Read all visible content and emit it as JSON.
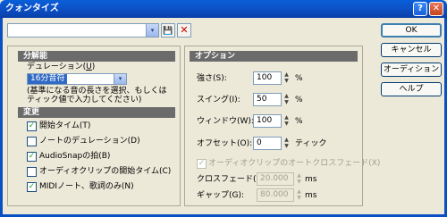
{
  "window": {
    "title": "クォンタイズ",
    "help": "?",
    "close": "✕"
  },
  "toolbar": {
    "preset_value": "",
    "dropdown_glyph": "▾",
    "save_glyph": "💾",
    "delete_glyph": "✕"
  },
  "resolution": {
    "header": "分解能",
    "duration_label": "デュレーション(",
    "duration_accel": "U",
    "duration_value": "16分音符",
    "help_text_1": "(基準になる音の長さを選択、もしくは",
    "help_text_2": "ティック値で入力してください)"
  },
  "changes": {
    "header": "変更",
    "items": [
      {
        "label": "開始タイム(T)",
        "checked": true
      },
      {
        "label": "ノートのデュレーション(D)",
        "checked": false
      },
      {
        "label": "AudioSnapの拍(B)",
        "checked": true
      },
      {
        "label": "オーディオクリップの開始タイム(C)",
        "checked": false
      },
      {
        "label": "MIDIノート、歌詞のみ(N)",
        "checked": true
      }
    ]
  },
  "options": {
    "header": "オプション",
    "strength": {
      "label": "強さ(S):",
      "value": "100",
      "unit": "%"
    },
    "swing": {
      "label": "スイング(I):",
      "value": "50",
      "unit": "%"
    },
    "window": {
      "label": "ウィンドウ(W):",
      "value": "100",
      "unit": "%"
    },
    "offset": {
      "label": "オフセット(O):",
      "value": "0",
      "unit": "ティック"
    },
    "auto_crossfade": {
      "label": "オーディオクリップのオートクロスフェード(X)",
      "checked": true
    },
    "crossfade": {
      "label": "クロスフェード(E):",
      "value": "20.000",
      "unit": "ms"
    },
    "gap": {
      "label": "ギャップ(G):",
      "value": "80.000",
      "unit": "ms"
    }
  },
  "buttons": {
    "ok": "OK",
    "cancel": "キャンセル",
    "audition": "オーディション",
    "help": "ヘルプ"
  },
  "spin_glyphs": {
    "up": "▲",
    "down": "▼"
  }
}
